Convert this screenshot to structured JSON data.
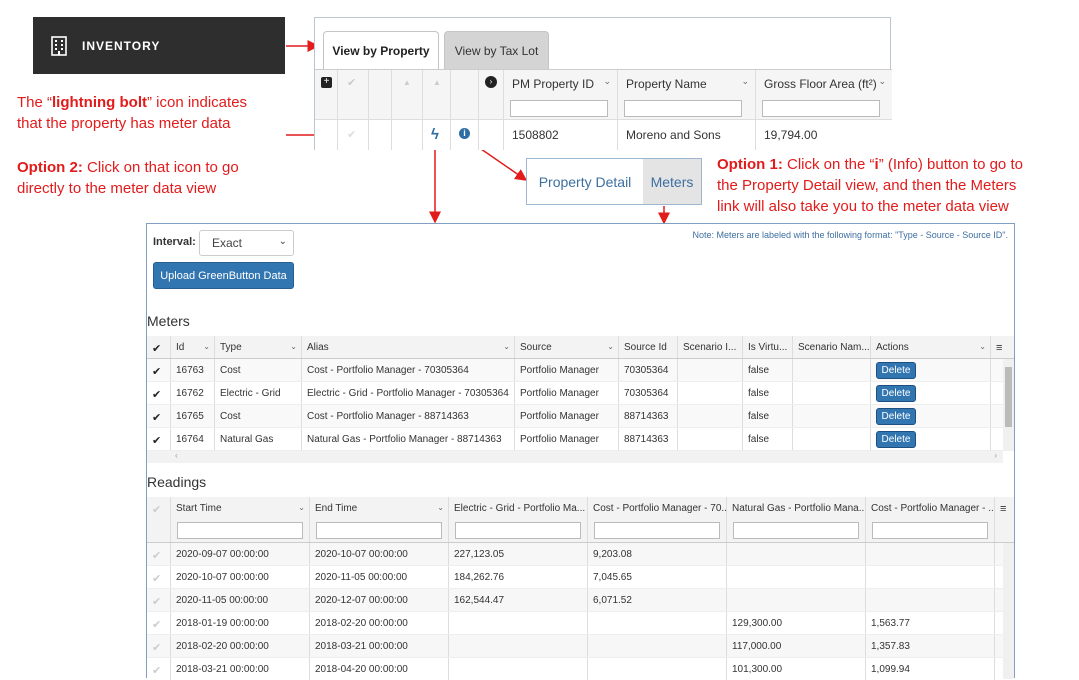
{
  "inventory": {
    "label": "INVENTORY"
  },
  "tabs": {
    "view_by_property": "View by Property",
    "view_by_tax_lot": "View by Tax Lot"
  },
  "prop_grid": {
    "headers": [
      "PM Property ID",
      "Property Name",
      "Gross Floor Area (ft²)"
    ],
    "row": {
      "pm_id": "1508802",
      "name": "Moreno and Sons",
      "gfa": "19,794.00"
    }
  },
  "annotations": {
    "lightning_pre": "The “",
    "lightning_bold": "lightning bolt",
    "lightning_post": "” icon indicates",
    "lightning_line2": "that the property has meter data",
    "opt2_bold": "Option 2:",
    "opt2_text": " Click on that icon to go",
    "opt2_line2": "directly to the meter data view",
    "opt1_bold": "Option 1:",
    "opt1_text_a": " Click on the “",
    "opt1_i": "i",
    "opt1_text_b": "” (Info) button to go to",
    "opt1_line2": "the Property Detail view, and then the Meters",
    "opt1_line3": "link will also take you to the meter data view"
  },
  "links": {
    "property_detail": "Property Detail",
    "meters": "Meters"
  },
  "meter_view": {
    "interval_label": "Interval:",
    "interval_value": "Exact",
    "note": "Note: Meters are labeled with the following format: \"Type - Source - Source ID\".",
    "upload_button": "Upload GreenButton Data",
    "meters_title": "Meters",
    "readings_title": "Readings"
  },
  "meters_table": {
    "headers": [
      "Id",
      "Type",
      "Alias",
      "Source",
      "Source Id",
      "Scenario I...",
      "Is Virtu...",
      "Scenario Nam...",
      "Actions"
    ],
    "rows": [
      {
        "id": "16763",
        "type": "Cost",
        "alias": "Cost - Portfolio Manager - 70305364",
        "source": "Portfolio Manager",
        "source_id": "70305364",
        "virtual": "false",
        "action": "Delete"
      },
      {
        "id": "16762",
        "type": "Electric - Grid",
        "alias": "Electric - Grid - Portfolio Manager - 70305364",
        "source": "Portfolio Manager",
        "source_id": "70305364",
        "virtual": "false",
        "action": "Delete"
      },
      {
        "id": "16765",
        "type": "Cost",
        "alias": "Cost - Portfolio Manager - 88714363",
        "source": "Portfolio Manager",
        "source_id": "88714363",
        "virtual": "false",
        "action": "Delete"
      },
      {
        "id": "16764",
        "type": "Natural Gas",
        "alias": "Natural Gas - Portfolio Manager - 88714363",
        "source": "Portfolio Manager",
        "source_id": "88714363",
        "virtual": "false",
        "action": "Delete"
      }
    ]
  },
  "readings_table": {
    "headers": [
      "Start Time",
      "End Time",
      "Electric - Grid - Portfolio Ma...",
      "Cost - Portfolio Manager - 70...",
      "Natural Gas - Portfolio Mana...",
      "Cost - Portfolio Manager - ..."
    ],
    "rows": [
      {
        "start": "2020-09-07 00:00:00",
        "end": "2020-10-07 00:00:00",
        "elec": "227,123.05",
        "cost1": "9,203.08",
        "gas": "",
        "cost2": ""
      },
      {
        "start": "2020-10-07 00:00:00",
        "end": "2020-11-05 00:00:00",
        "elec": "184,262.76",
        "cost1": "7,045.65",
        "gas": "",
        "cost2": ""
      },
      {
        "start": "2020-11-05 00:00:00",
        "end": "2020-12-07 00:00:00",
        "elec": "162,544.47",
        "cost1": "6,071.52",
        "gas": "",
        "cost2": ""
      },
      {
        "start": "2018-01-19 00:00:00",
        "end": "2018-02-20 00:00:00",
        "elec": "",
        "cost1": "",
        "gas": "129,300.00",
        "cost2": "1,563.77"
      },
      {
        "start": "2018-02-20 00:00:00",
        "end": "2018-03-21 00:00:00",
        "elec": "",
        "cost1": "",
        "gas": "117,000.00",
        "cost2": "1,357.83"
      },
      {
        "start": "2018-03-21 00:00:00",
        "end": "2018-04-20 00:00:00",
        "elec": "",
        "cost1": "",
        "gas": "101,300.00",
        "cost2": "1,099.94"
      }
    ]
  },
  "colors": {
    "annotation_red": "#e21b1b",
    "button_blue": "#3276b1",
    "link_blue": "#3d6fa1"
  }
}
